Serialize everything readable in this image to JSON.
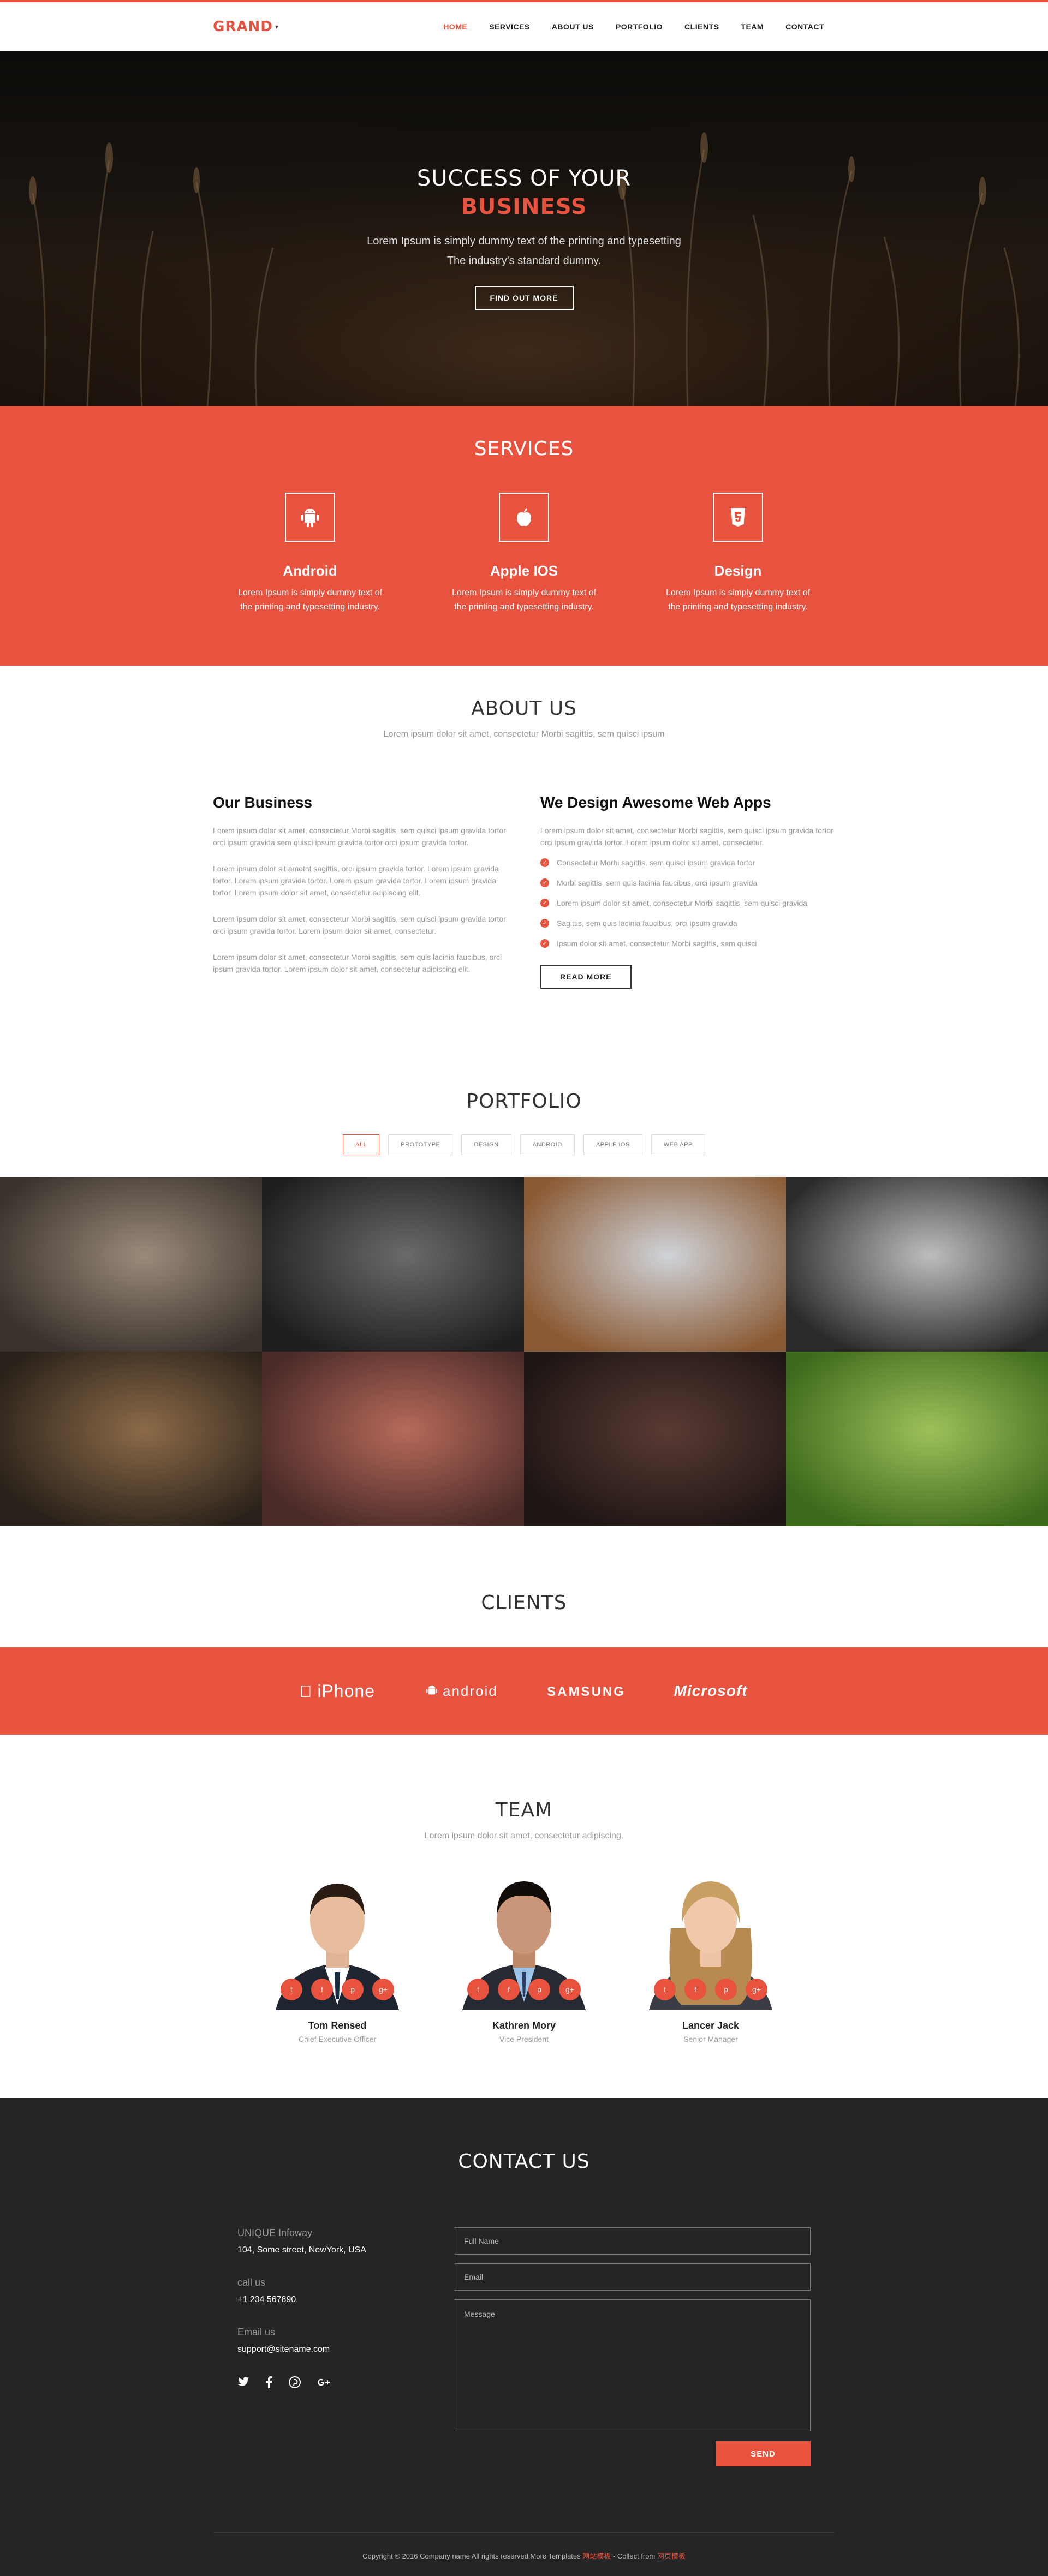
{
  "nav": {
    "logo": "GRAND",
    "items": [
      "HOME",
      "SERVICES",
      "ABOUT US",
      "PORTFOLIO",
      "CLIENTS",
      "TEAM",
      "CONTACT"
    ],
    "active_index": 0
  },
  "hero": {
    "title": "SUCCESS OF YOUR",
    "highlight": "BUSINESS",
    "line1": "Lorem Ipsum is simply dummy text of the printing and typesetting",
    "line2": "The industry's standard dummy.",
    "button": "FIND OUT MORE"
  },
  "services": {
    "title": "SERVICES",
    "items": [
      {
        "icon": "android-icon",
        "name": "Android",
        "desc": "Lorem Ipsum is simply dummy text of the printing and typesetting industry."
      },
      {
        "icon": "apple-icon",
        "name": "Apple IOS",
        "desc": "Lorem Ipsum is simply dummy text of the printing and typesetting industry."
      },
      {
        "icon": "html5-icon",
        "name": "Design",
        "desc": "Lorem Ipsum is simply dummy text of the printing and typesetting industry."
      }
    ]
  },
  "about": {
    "title": "ABOUT US",
    "subtitle": "Lorem ipsum dolor sit amet, consectetur Morbi sagittis, sem quisci ipsum",
    "left": {
      "heading": "Our Business",
      "paragraphs": [
        "Lorem ipsum dolor sit amet, consectetur Morbi sagittis, sem quisci ipsum gravida tortor orci ipsum gravida sem quisci ipsum gravida tortor orci ipsum gravida tortor.",
        "Lorem ipsum dolor sit ametnt sagittis, orci ipsum gravida tortor. Lorem ipsum gravida tortor. Lorem ipsum gravida tortor. Lorem ipsum gravida tortor. Lorem ipsum gravida tortor. Lorem ipsum dolor sit amet, consectetur adipiscing elit.",
        "Lorem ipsum dolor sit amet, consectetur Morbi sagittis, sem quisci ipsum gravida tortor orci ipsum gravida tortor. Lorem ipsum dolor sit amet, consectetur.",
        "Lorem ipsum dolor sit amet, consectetur Morbi sagittis, sem quis lacinia faucibus, orci ipsum gravida tortor. Lorem ipsum dolor sit amet, consectetur adipiscing elit."
      ]
    },
    "right": {
      "heading": "We Design Awesome Web Apps",
      "intro": "Lorem ipsum dolor sit amet, consectetur Morbi sagittis, sem quisci ipsum gravida tortor orci ipsum gravida tortor. Lorem ipsum dolor sit amet, consectetur.",
      "checks": [
        "Consectetur Morbi sagittis, sem quisci ipsum gravida tortor",
        "Morbi sagittis, sem quis lacinia faucibus, orci ipsum gravida",
        "Lorem ipsum dolor sit amet, consectetur Morbi sagittis, sem quisci gravida",
        "Sagittis, sem quis lacinia faucibus, orci ipsum gravida",
        "Ipsum dolor sit amet, consectetur Morbi sagittis, sem quisci"
      ],
      "button": "READ MORE"
    }
  },
  "portfolio": {
    "title": "PORTFOLIO",
    "filters": [
      "ALL",
      "PROTOTYPE",
      "DESIGN",
      "ANDROID",
      "APPLE IOS",
      "WEB APP"
    ],
    "active_filter": 0,
    "tiles": [
      {
        "name": "mixing-console",
        "colors": [
          "#9a8a7a",
          "#3a332d"
        ]
      },
      {
        "name": "speaker-device",
        "colors": [
          "#6a6a6a",
          "#1f1f1f"
        ]
      },
      {
        "name": "laptop-on-desk",
        "colors": [
          "#cfd3d8",
          "#8a5a34"
        ]
      },
      {
        "name": "turntable",
        "colors": [
          "#bdbdbd",
          "#2a2a2a"
        ]
      },
      {
        "name": "hands-writing",
        "colors": [
          "#8c6a48",
          "#2a221a"
        ]
      },
      {
        "name": "headphones",
        "colors": [
          "#b66a5a",
          "#4a2a28"
        ]
      },
      {
        "name": "person-laptop",
        "colors": [
          "#5a3a34",
          "#1e1614"
        ]
      },
      {
        "name": "laptop-on-grass",
        "colors": [
          "#9cc05a",
          "#3e6a1c"
        ]
      }
    ]
  },
  "clients": {
    "title": "CLIENTS",
    "logos": [
      "iPhone",
      "android",
      "SAMSUNG",
      "Microsoft"
    ]
  },
  "team": {
    "title": "TEAM",
    "subtitle": "Lorem ipsum dolor sit amet, consectetur adipiscing.",
    "members": [
      {
        "name": "Tom Rensed",
        "role": "Chief Executive Officer"
      },
      {
        "name": "Kathren Mory",
        "role": "Vice President"
      },
      {
        "name": "Lancer Jack",
        "role": "Senior Manager"
      }
    ]
  },
  "contact": {
    "title": "CONTACT US",
    "company_label": "UNIQUE Infoway",
    "address": "104, Some street, NewYork, USA",
    "call_label": "call us",
    "phone": "+1 234 567890",
    "email_label": "Email us",
    "email": "support@sitename.com",
    "fields": {
      "name": "Full Name",
      "email": "Email",
      "message": "Message"
    },
    "send": "SEND",
    "copyright": "Copyright © 2016 Company name All rights reserved.More Templates",
    "copyright_link1": "网站模板",
    "copyright_mid": "- Collect from",
    "copyright_link2": "网页模板"
  },
  "colors": {
    "accent": "#e8533f",
    "dark": "#252525"
  }
}
